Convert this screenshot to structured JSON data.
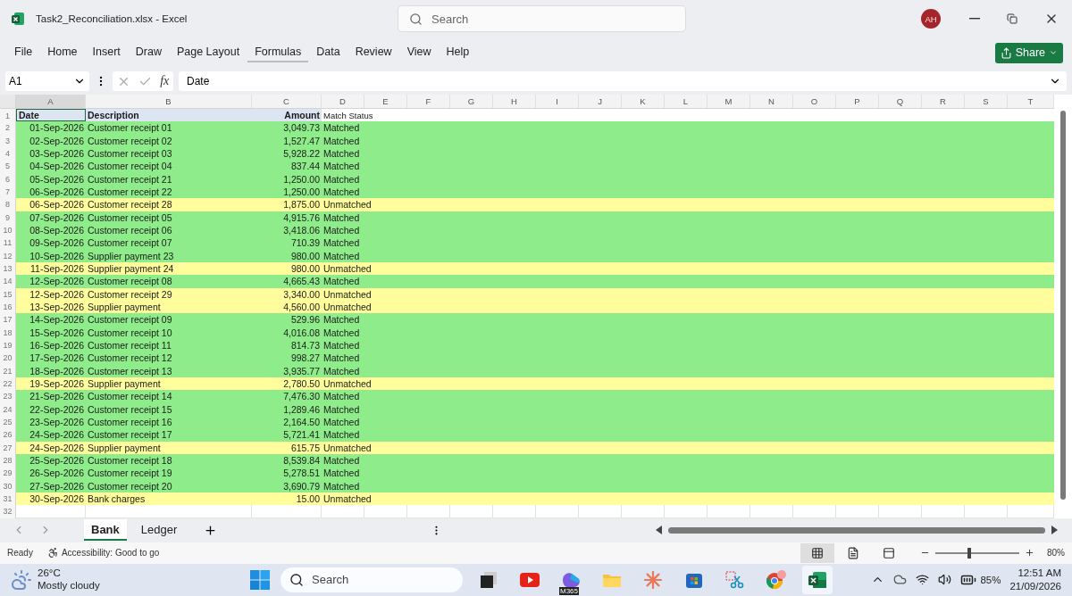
{
  "window": {
    "title": "Task2_Reconciliation.xlsx  -  Excel",
    "search_placeholder": "Search",
    "avatar": "AH"
  },
  "menu": [
    {
      "label": "File",
      "selected": false
    },
    {
      "label": "Home",
      "selected": false
    },
    {
      "label": "Insert",
      "selected": false
    },
    {
      "label": "Draw",
      "selected": false
    },
    {
      "label": "Page Layout",
      "selected": false
    },
    {
      "label": "Formulas",
      "selected": true
    },
    {
      "label": "Data",
      "selected": false
    },
    {
      "label": "Review",
      "selected": false
    },
    {
      "label": "View",
      "selected": false
    },
    {
      "label": "Help",
      "selected": false
    }
  ],
  "share_button": "Share",
  "formula_bar": {
    "name_box": "A1",
    "function_label": "fx",
    "value": "Date"
  },
  "columns": [
    {
      "label": "A",
      "selected": true
    },
    {
      "label": "B",
      "selected": false
    },
    {
      "label": "C",
      "selected": false
    },
    {
      "label": "D",
      "selected": false
    },
    {
      "label": "E",
      "selected": false
    },
    {
      "label": "F",
      "selected": false
    },
    {
      "label": "G",
      "selected": false
    },
    {
      "label": "H",
      "selected": false
    },
    {
      "label": "I",
      "selected": false
    },
    {
      "label": "J",
      "selected": false
    },
    {
      "label": "K",
      "selected": false
    },
    {
      "label": "L",
      "selected": false
    },
    {
      "label": "M",
      "selected": false
    },
    {
      "label": "N",
      "selected": false
    },
    {
      "label": "O",
      "selected": false
    },
    {
      "label": "P",
      "selected": false
    },
    {
      "label": "Q",
      "selected": false
    },
    {
      "label": "R",
      "selected": false
    },
    {
      "label": "S",
      "selected": false
    },
    {
      "label": "T",
      "selected": false
    }
  ],
  "header_row": {
    "number": "1",
    "cells": [
      "Date",
      "Description",
      "Amount",
      "Match Status"
    ]
  },
  "rows": [
    {
      "number": "2",
      "date": "01-Sep-2026",
      "description": "Customer receipt 01",
      "amount": "3,049.73",
      "status": "Matched",
      "color": "#8fec8a"
    },
    {
      "number": "3",
      "date": "02-Sep-2026",
      "description": "Customer receipt 02",
      "amount": "1,527.47",
      "status": "Matched",
      "color": "#8fec8a"
    },
    {
      "number": "4",
      "date": "03-Sep-2026",
      "description": "Customer receipt 03",
      "amount": "5,928.22",
      "status": "Matched",
      "color": "#8fec8a"
    },
    {
      "number": "5",
      "date": "04-Sep-2026",
      "description": "Customer receipt 04",
      "amount": "837.44",
      "status": "Matched",
      "color": "#8fec8a"
    },
    {
      "number": "6",
      "date": "05-Sep-2026",
      "description": "Customer receipt 21",
      "amount": "1,250.00",
      "status": "Matched",
      "color": "#8fec8a"
    },
    {
      "number": "7",
      "date": "06-Sep-2026",
      "description": "Customer receipt 22",
      "amount": "1,250.00",
      "status": "Matched",
      "color": "#8fec8a"
    },
    {
      "number": "8",
      "date": "06-Sep-2026",
      "description": "Customer receipt 28",
      "amount": "1,875.00",
      "status": "Unmatched",
      "color": "#fffd9c"
    },
    {
      "number": "9",
      "date": "07-Sep-2026",
      "description": "Customer receipt 05",
      "amount": "4,915.76",
      "status": "Matched",
      "color": "#8fec8a"
    },
    {
      "number": "10",
      "date": "08-Sep-2026",
      "description": "Customer receipt 06",
      "amount": "3,418.06",
      "status": "Matched",
      "color": "#8fec8a"
    },
    {
      "number": "11",
      "date": "09-Sep-2026",
      "description": "Customer receipt 07",
      "amount": "710.39",
      "status": "Matched",
      "color": "#8fec8a"
    },
    {
      "number": "12",
      "date": "10-Sep-2026",
      "description": "Supplier payment 23",
      "amount": "980.00",
      "status": "Matched",
      "color": "#8fec8a"
    },
    {
      "number": "13",
      "date": "11-Sep-2026",
      "description": "Supplier payment 24",
      "amount": "980.00",
      "status": "Unmatched",
      "color": "#fffd9c"
    },
    {
      "number": "14",
      "date": "12-Sep-2026",
      "description": "Customer receipt 08",
      "amount": "4,665.43",
      "status": "Matched",
      "color": "#8fec8a"
    },
    {
      "number": "15",
      "date": "12-Sep-2026",
      "description": "Customer receipt 29",
      "amount": "3,340.00",
      "status": "Unmatched",
      "color": "#fffd9c"
    },
    {
      "number": "16",
      "date": "13-Sep-2026",
      "description": "Supplier payment",
      "amount": "4,560.00",
      "status": "Unmatched",
      "color": "#fffd9c"
    },
    {
      "number": "17",
      "date": "14-Sep-2026",
      "description": "Customer receipt 09",
      "amount": "529.96",
      "status": "Matched",
      "color": "#8fec8a"
    },
    {
      "number": "18",
      "date": "15-Sep-2026",
      "description": "Customer receipt 10",
      "amount": "4,016.08",
      "status": "Matched",
      "color": "#8fec8a"
    },
    {
      "number": "19",
      "date": "16-Sep-2026",
      "description": "Customer receipt 11",
      "amount": "814.73",
      "status": "Matched",
      "color": "#8fec8a"
    },
    {
      "number": "20",
      "date": "17-Sep-2026",
      "description": "Customer receipt 12",
      "amount": "998.27",
      "status": "Matched",
      "color": "#8fec8a"
    },
    {
      "number": "21",
      "date": "18-Sep-2026",
      "description": "Customer receipt 13",
      "amount": "3,935.77",
      "status": "Matched",
      "color": "#8fec8a"
    },
    {
      "number": "22",
      "date": "19-Sep-2026",
      "description": "Supplier payment",
      "amount": "2,780.50",
      "status": "Unmatched",
      "color": "#fffd9c"
    },
    {
      "number": "23",
      "date": "21-Sep-2026",
      "description": "Customer receipt 14",
      "amount": "7,476.30",
      "status": "Matched",
      "color": "#8fec8a"
    },
    {
      "number": "24",
      "date": "22-Sep-2026",
      "description": "Customer receipt 15",
      "amount": "1,289.46",
      "status": "Matched",
      "color": "#8fec8a"
    },
    {
      "number": "25",
      "date": "23-Sep-2026",
      "description": "Customer receipt 16",
      "amount": "2,164.50",
      "status": "Matched",
      "color": "#8fec8a"
    },
    {
      "number": "26",
      "date": "24-Sep-2026",
      "description": "Customer receipt 17",
      "amount": "5,721.41",
      "status": "Matched",
      "color": "#8fec8a"
    },
    {
      "number": "27",
      "date": "24-Sep-2026",
      "description": "Supplier payment",
      "amount": "615.75",
      "status": "Unmatched",
      "color": "#fffd9c"
    },
    {
      "number": "28",
      "date": "25-Sep-2026",
      "description": "Customer receipt 18",
      "amount": "8,539.84",
      "status": "Matched",
      "color": "#8fec8a"
    },
    {
      "number": "29",
      "date": "26-Sep-2026",
      "description": "Customer receipt 19",
      "amount": "5,278.51",
      "status": "Matched",
      "color": "#8fec8a"
    },
    {
      "number": "30",
      "date": "27-Sep-2026",
      "description": "Customer receipt 20",
      "amount": "3,690.79",
      "status": "Matched",
      "color": "#8fec8a"
    },
    {
      "number": "31",
      "date": "30-Sep-2026",
      "description": "Bank charges",
      "amount": "15.00",
      "status": "Unmatched",
      "color": "#fffd9c"
    }
  ],
  "empty_row_number": "32",
  "sheet_tabs": [
    {
      "label": "Bank",
      "selected": true
    },
    {
      "label": "Ledger",
      "selected": false
    }
  ],
  "status_bar": {
    "ready": "Ready",
    "accessibility": "Accessibility: Good to go",
    "views": [
      {
        "kind": "normal",
        "selected": true
      },
      {
        "kind": "page_layout",
        "selected": false
      },
      {
        "kind": "page_break",
        "selected": false
      }
    ],
    "zoom": {
      "level": 0.4,
      "label": "80%"
    }
  },
  "taskbar": {
    "temperature": "26°C",
    "weather": "Mostly cloudy",
    "search_placeholder": "Search",
    "apps": [
      {
        "kind": "task_view",
        "active": false
      },
      {
        "kind": "video",
        "active": false
      },
      {
        "kind": "m365",
        "active": false,
        "badge": "M365"
      },
      {
        "kind": "folder",
        "active": false
      },
      {
        "kind": "starburst",
        "active": false
      },
      {
        "kind": "store",
        "active": false
      },
      {
        "kind": "snip",
        "active": false
      },
      {
        "kind": "browser",
        "active": false
      },
      {
        "kind": "excel",
        "active": true
      }
    ],
    "battery": "85%",
    "time": "12:51 AM",
    "date": "21/09/2026"
  }
}
